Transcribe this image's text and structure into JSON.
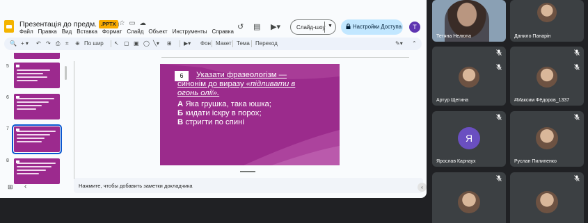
{
  "slides_app": {
    "doc_title": "Презентація до предм. тижня",
    "file_badge": ".PPTX",
    "menu": [
      "Файл",
      "Правка",
      "Вид",
      "Вставка",
      "Формат",
      "Слайд",
      "Объект",
      "Инструменты",
      "Справка"
    ],
    "slideshow_label": "Слайд-шоу",
    "access_label": "Настройки Доступа",
    "account_initial": "T",
    "toolbar": {
      "zoom": "По шир",
      "background": "Фон",
      "layout": "Макет",
      "theme": "Тема",
      "transition": "Переход"
    },
    "thumbnails": [
      {
        "num": "5"
      },
      {
        "num": "6"
      },
      {
        "num": "7",
        "selected": true
      },
      {
        "num": "8"
      }
    ],
    "slide": {
      "number": "6",
      "question_lines": [
        "Указати фразеологізм —",
        "синонім до виразу",
        "«підливати в",
        "огонь олії»."
      ],
      "options": [
        {
          "letter": "А",
          "text": "Яка грушка, така юшка;"
        },
        {
          "letter": "Б",
          "text": "кидати іскру в порох;"
        },
        {
          "letter": "В",
          "text": "стригти по спині"
        }
      ]
    },
    "notes_placeholder": "Нажмите, чтобы добавить заметки докладчика"
  },
  "meet": {
    "participants": [
      {
        "name": "Тетяна Нелюпа",
        "kind": "video"
      },
      {
        "name": "Данило Панарін",
        "kind": "photo"
      },
      {
        "name": "",
        "kind": "blank"
      },
      {
        "name": "",
        "kind": "blank"
      },
      {
        "name": "Артур Щетина",
        "kind": "photo"
      },
      {
        "name": "#Максим Фёдоров_1337",
        "kind": "photo"
      },
      {
        "name": "Ярослав Карнаух",
        "kind": "letter",
        "initial": "Я"
      },
      {
        "name": "Руслан Пилипенко",
        "kind": "photo"
      },
      {
        "name": "",
        "kind": "photo"
      },
      {
        "name": "",
        "kind": "photo"
      }
    ]
  }
}
